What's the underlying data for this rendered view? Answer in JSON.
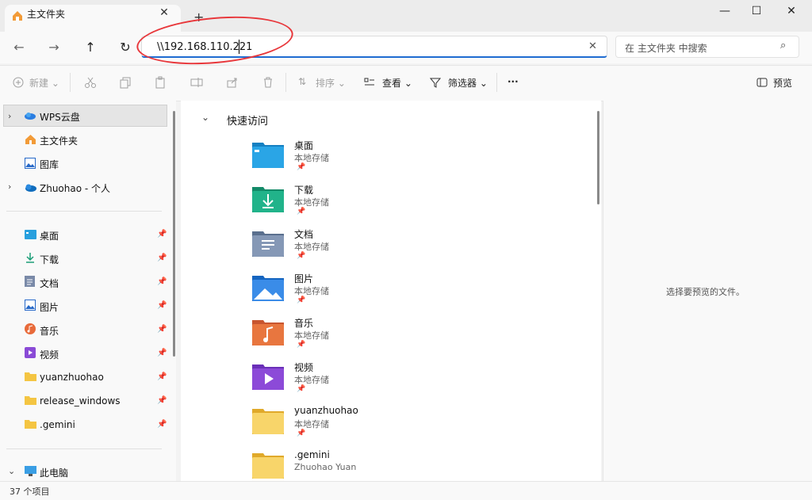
{
  "tab": {
    "title": "主文件夹",
    "close": "✕",
    "new_tab": "+"
  },
  "window": {
    "minimize": "—",
    "maximize": "☐",
    "close": "✕"
  },
  "nav": {
    "back": "←",
    "forward": "→",
    "up": "↑",
    "refresh": "↻"
  },
  "address": {
    "value": "\\\\192.168.110.221",
    "clear": "✕"
  },
  "search": {
    "placeholder": "在 主文件夹 中搜索",
    "icon": "⌕"
  },
  "toolbar": {
    "new": "新建",
    "sort": "排序",
    "view": "查看",
    "filter": "筛选器",
    "more": "···",
    "preview": "预览"
  },
  "sidebar": {
    "top_items": [
      {
        "label": "WPS云盘",
        "icon": "wps-cloud-icon"
      },
      {
        "label": "主文件夹",
        "icon": "home-icon"
      },
      {
        "label": "图库",
        "icon": "gallery-icon"
      },
      {
        "label": "Zhuohao - 个人",
        "icon": "onedrive-icon"
      }
    ],
    "pinned_items": [
      {
        "label": "桌面",
        "icon": "desktop-icon"
      },
      {
        "label": "下载",
        "icon": "download-icon"
      },
      {
        "label": "文档",
        "icon": "documents-icon"
      },
      {
        "label": "图片",
        "icon": "pictures-icon"
      },
      {
        "label": "音乐",
        "icon": "music-icon"
      },
      {
        "label": "视频",
        "icon": "videos-icon"
      },
      {
        "label": "yuanzhuohao",
        "icon": "folder-icon"
      },
      {
        "label": "release_windows",
        "icon": "folder-icon"
      },
      {
        "label": ".gemini",
        "icon": "folder-icon"
      }
    ],
    "this_pc": "此电脑"
  },
  "main": {
    "section_title": "快速访问",
    "items": [
      {
        "name": "桌面",
        "sub": "本地存储",
        "icon": "desktop-folder-icon"
      },
      {
        "name": "下载",
        "sub": "本地存储",
        "icon": "download-folder-icon"
      },
      {
        "name": "文档",
        "sub": "本地存储",
        "icon": "documents-folder-icon"
      },
      {
        "name": "图片",
        "sub": "本地存储",
        "icon": "pictures-folder-icon"
      },
      {
        "name": "音乐",
        "sub": "本地存储",
        "icon": "music-folder-icon"
      },
      {
        "name": "视频",
        "sub": "本地存储",
        "icon": "videos-folder-icon"
      },
      {
        "name": "yuanzhuohao",
        "sub": "本地存储",
        "icon": "folder-icon"
      },
      {
        "name": ".gemini",
        "sub": "Zhuohao Yuan",
        "icon": "folder-icon"
      }
    ]
  },
  "preview": {
    "message": "选择要预览的文件。"
  },
  "status": {
    "count": "37 个项目"
  },
  "colors": {
    "accent": "#1f6cd1",
    "annotation": "#e8373b",
    "folder": "#f4c542"
  }
}
